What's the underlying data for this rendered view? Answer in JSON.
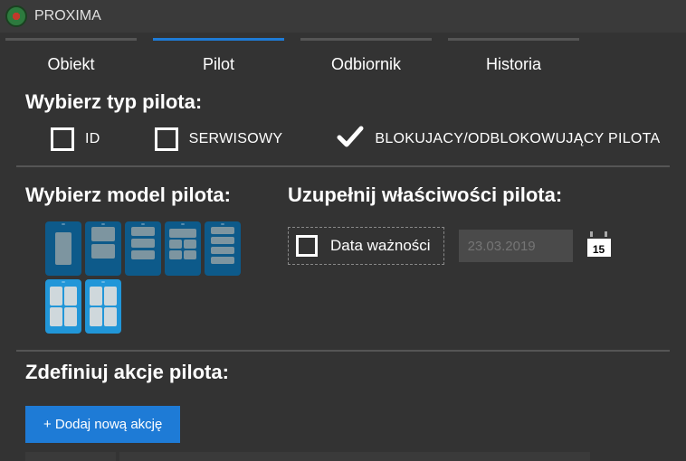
{
  "app": {
    "title": "PROXIMA"
  },
  "tabs": {
    "items": [
      {
        "label": "Obiekt"
      },
      {
        "label": "Pilot"
      },
      {
        "label": "Odbiornik"
      },
      {
        "label": "Historia"
      }
    ],
    "activeIndex": 1
  },
  "sections": {
    "type_heading": "Wybierz typ pilota:",
    "model_heading": "Wybierz model pilota:",
    "props_heading": "Uzupełnij właściwości pilota:",
    "actions_heading": "Zdefiniuj akcje pilota:"
  },
  "type_options": {
    "id": "ID",
    "service": "SERWISOWY",
    "blocking": "BLOKUJACY/ODBLOKOWUJĄCY PILOTA"
  },
  "props": {
    "expiry_label": "Data ważności",
    "expiry_placeholder": "23.03.2019",
    "calendar_day": "15"
  },
  "buttons": {
    "add_action": "+ Dodaj nową akcję"
  }
}
